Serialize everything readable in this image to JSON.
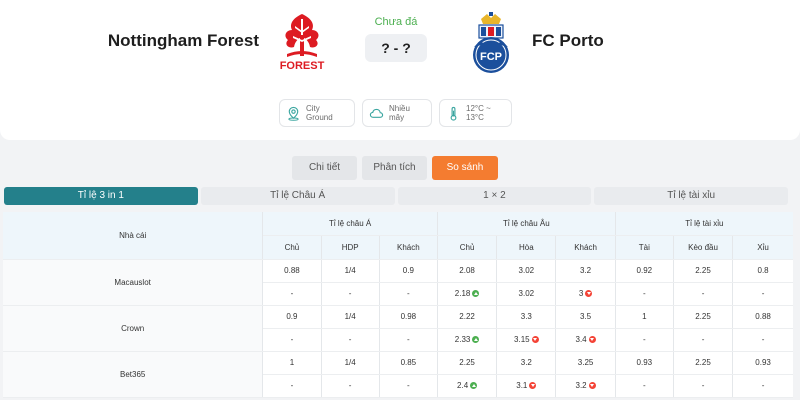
{
  "match": {
    "home_team": "Nottingham Forest",
    "away_team": "FC Porto",
    "home_crest_text": "FOREST",
    "away_crest_text": "FCP",
    "status": "Chưa đá",
    "score": "? - ?",
    "stadium": "City Ground",
    "weather": "Nhiều mây",
    "temperature": "12°C ~ 13°C"
  },
  "tabs": [
    {
      "label": "Chi tiết",
      "active": false
    },
    {
      "label": "Phân tích",
      "active": false
    },
    {
      "label": "So sánh",
      "active": true
    }
  ],
  "subtabs": [
    {
      "label": "Tỉ lệ 3 in 1",
      "active": true
    },
    {
      "label": "Tỉ lệ Châu Á",
      "active": false
    },
    {
      "label": "1 × 2",
      "active": false
    },
    {
      "label": "Tỉ lệ tài xỉu",
      "active": false
    }
  ],
  "table": {
    "bookmaker_header": "Nhà cái",
    "groups": [
      "Tỉ lệ châu Á",
      "Tỉ lệ châu Âu",
      "Tỉ lệ tài xỉu"
    ],
    "columns": [
      "Chủ",
      "HDP",
      "Khách",
      "Chủ",
      "Hòa",
      "Khách",
      "Tài",
      "Kèo đầu",
      "Xỉu"
    ],
    "rows": [
      {
        "bookmaker": "Macauslot",
        "line1": [
          "0.88",
          "1/4",
          "0.9",
          "2.08",
          "3.02",
          "3.2",
          "0.92",
          "2.25",
          "0.8"
        ],
        "line2": [
          "-",
          "-",
          "-",
          "2.18",
          "3.02",
          "3",
          "-",
          "-",
          "-"
        ],
        "line2_trend": [
          "",
          "",
          "",
          "up",
          "",
          "down",
          "",
          "",
          ""
        ]
      },
      {
        "bookmaker": "Crown",
        "line1": [
          "0.9",
          "1/4",
          "0.98",
          "2.22",
          "3.3",
          "3.5",
          "1",
          "2.25",
          "0.88"
        ],
        "line2": [
          "-",
          "-",
          "-",
          "2.33",
          "3.15",
          "3.4",
          "-",
          "-",
          "-"
        ],
        "line2_trend": [
          "",
          "",
          "",
          "up",
          "down",
          "down",
          "",
          "",
          ""
        ]
      },
      {
        "bookmaker": "Bet365",
        "line1": [
          "1",
          "1/4",
          "0.85",
          "2.25",
          "3.2",
          "3.25",
          "0.93",
          "2.25",
          "0.93"
        ],
        "line2": [
          "-",
          "-",
          "-",
          "2.4",
          "3.1",
          "3.2",
          "-",
          "-",
          "-"
        ],
        "line2_trend": [
          "",
          "",
          "",
          "up",
          "down",
          "down",
          "",
          "",
          ""
        ]
      }
    ]
  },
  "colors": {
    "accent_orange": "#f47c30",
    "accent_teal": "#24808b",
    "forest_red": "#dd1b22",
    "porto_blue": "#1b4f9c",
    "up_green": "#4caf50",
    "down_red": "#f44336"
  }
}
